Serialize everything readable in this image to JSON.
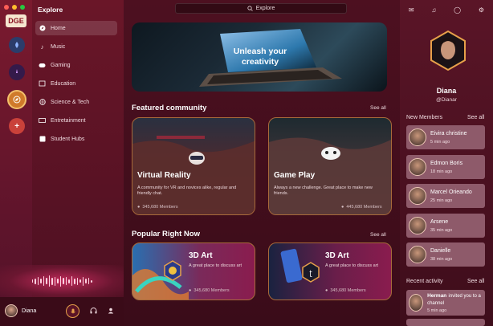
{
  "nav": {
    "title": "Explore",
    "items": [
      {
        "label": "Home",
        "icon": "compass-icon"
      },
      {
        "label": "Music",
        "icon": "music-icon"
      },
      {
        "label": "Gaming",
        "icon": "gamepad-icon"
      },
      {
        "label": "Education",
        "icon": "education-icon"
      },
      {
        "label": "Science & Tech",
        "icon": "globe-icon"
      },
      {
        "label": "Entretainment",
        "icon": "tv-icon"
      },
      {
        "label": "Student Hubs",
        "icon": "hub-icon"
      }
    ]
  },
  "rail": {
    "logo": "DGE",
    "add": "+"
  },
  "user": {
    "name": "Diana"
  },
  "search": {
    "label": "Explore"
  },
  "hero": {
    "text": "Unleash your creativity"
  },
  "featured": {
    "title": "Featured community",
    "see_all": "See all",
    "cards": [
      {
        "title": "Virtual Reality",
        "desc": "A community for VR and novices alike, regular and friendly chat.",
        "members": "345,680 Members"
      },
      {
        "title": "Game Play",
        "desc": "Always a new challenge. Great place to make new friends.",
        "members": "445,680 Members"
      }
    ]
  },
  "popular": {
    "title": "Popular Right Now",
    "see_all": "See all",
    "cards": [
      {
        "title": "3D Art",
        "desc": "A great place to discuss art",
        "members": "345,680 Members"
      },
      {
        "title": "3D Art",
        "desc": "A great place to discuss art",
        "members": "345,680 Members"
      }
    ]
  },
  "profile": {
    "name": "Diana",
    "handle": "@Dianar"
  },
  "new_members": {
    "title": "New Members",
    "see_all": "See all",
    "items": [
      {
        "name": "Eivira christine",
        "time": "5 min ago"
      },
      {
        "name": "Edmon Boris",
        "time": "18 min ago"
      },
      {
        "name": "Marcel Orieando",
        "time": "25 min ago"
      },
      {
        "name": "Arsene",
        "time": "35 min ago"
      },
      {
        "name": "Danielle",
        "time": "38 min ago"
      }
    ]
  },
  "recent": {
    "title": "Recent activity",
    "see_all": "See all",
    "item": {
      "name": "Herman",
      "text": "invited you to a channel",
      "time": "5 min ago"
    }
  },
  "colors": {
    "accent": "#e6a04a",
    "bg": "#4d1020"
  }
}
